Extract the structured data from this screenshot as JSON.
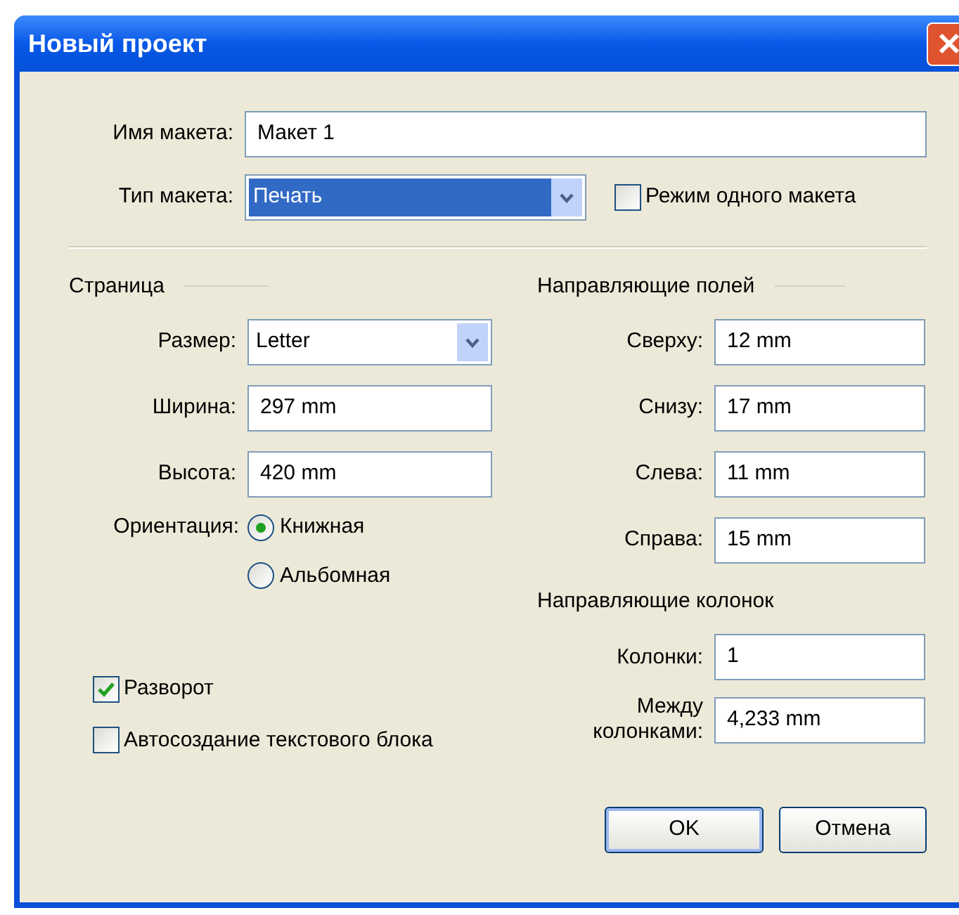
{
  "window": {
    "title": "Новый проект"
  },
  "layout_name": {
    "label": "Имя макета:",
    "value": "Макет 1"
  },
  "layout_type": {
    "label": "Тип макета:",
    "value": "Печать",
    "single_mode": {
      "label": "Режим одного макета",
      "checked": false
    }
  },
  "page": {
    "heading": "Страница",
    "fields": [
      {
        "kind": "select",
        "label": "Размер:",
        "value": "Letter"
      },
      {
        "kind": "text",
        "label": "Ширина:",
        "value": "297 mm"
      },
      {
        "kind": "text",
        "label": "Высота:",
        "value": "420 mm"
      }
    ],
    "orientation": {
      "label": "Ориентация:",
      "options": [
        {
          "label": "Книжная",
          "selected": true
        },
        {
          "label": "Альбомная",
          "selected": false
        }
      ]
    }
  },
  "options": [
    {
      "label": "Разворот",
      "checked": true
    },
    {
      "label": "Автосоздание текстового блока",
      "checked": false
    }
  ],
  "margin_guides": {
    "heading": "Направляющие полей",
    "fields": [
      {
        "label": "Сверху:",
        "value": "12 mm"
      },
      {
        "label": "Снизу:",
        "value": "17 mm"
      },
      {
        "label": "Слева:",
        "value": "11 mm"
      },
      {
        "label": "Справа:",
        "value": "15 mm"
      }
    ]
  },
  "column_guides": {
    "heading": "Направляющие колонок",
    "fields": [
      {
        "label": "Колонки:",
        "value": "1"
      },
      {
        "label": "Между колонками:",
        "value": "4,233 mm"
      }
    ]
  },
  "buttons": [
    {
      "label": "OK",
      "default": true
    },
    {
      "label": "Отмена",
      "default": false
    }
  ]
}
